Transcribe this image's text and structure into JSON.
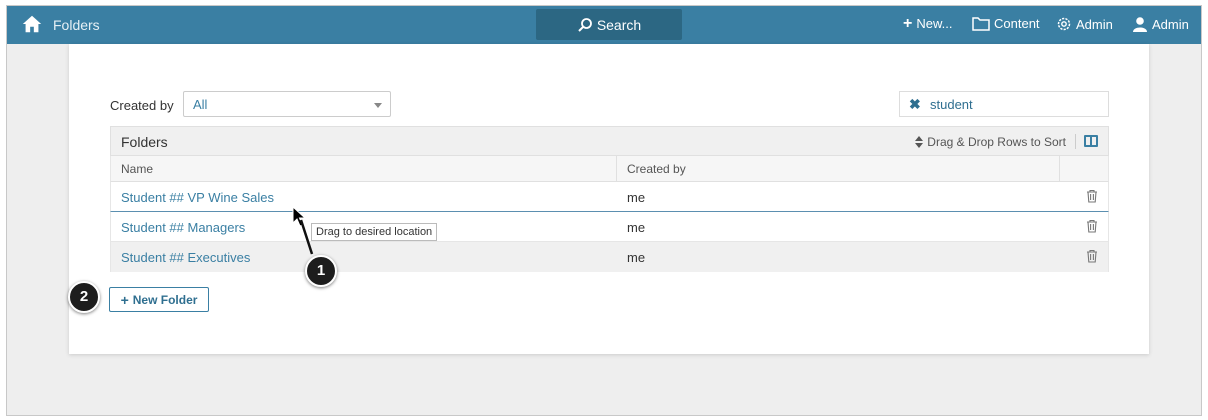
{
  "topbar": {
    "title": "Folders",
    "search_label": "Search",
    "new_label": "New...",
    "content_label": "Content",
    "admin_settings_label": "Admin",
    "admin_user_label": "Admin"
  },
  "filters": {
    "created_by_label": "Created by",
    "created_by_value": "All",
    "search_value": "student"
  },
  "table": {
    "title": "Folders",
    "sort_hint": "Drag & Drop Rows to Sort",
    "columns": [
      "Name",
      "Created by"
    ],
    "rows": [
      {
        "name": "Student ## VP Wine Sales",
        "created_by": "me"
      },
      {
        "name": "Student ## Managers",
        "created_by": "me"
      },
      {
        "name": "Student ## Executives",
        "created_by": "me"
      }
    ]
  },
  "tooltip": "Drag to desired location",
  "new_folder_label": "New Folder",
  "callouts": [
    "1",
    "2"
  ],
  "colors": {
    "topbar": "#3a7fa3",
    "link": "#3a7fa3",
    "search_button": "#2c6783"
  }
}
